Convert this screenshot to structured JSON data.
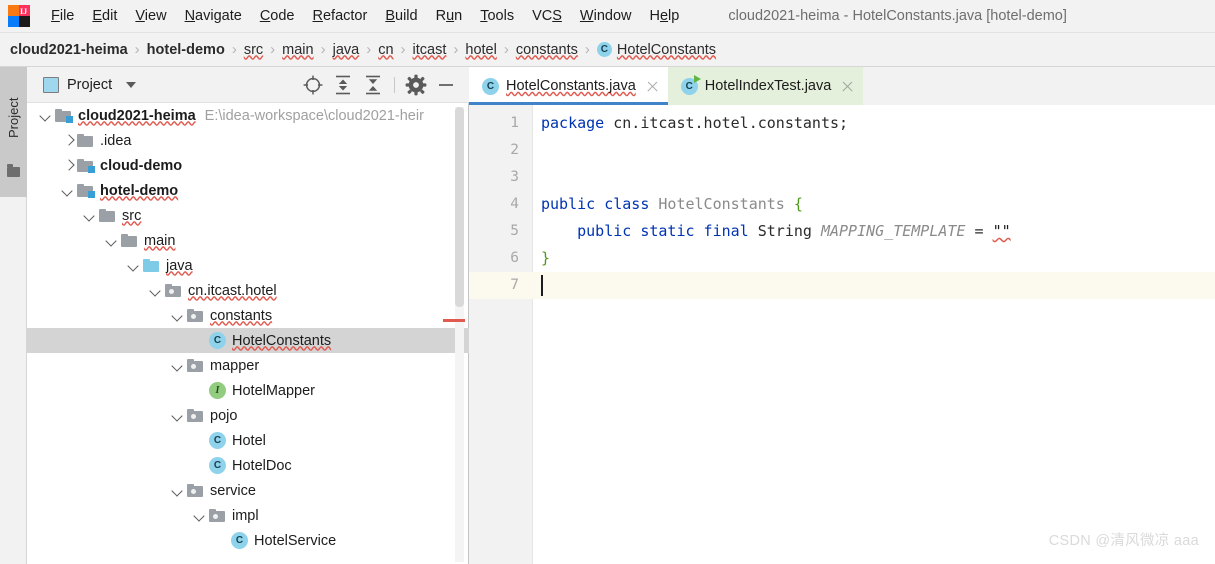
{
  "window": {
    "title": "cloud2021-heima - HotelConstants.java [hotel-demo]",
    "logo_letters": "IJ"
  },
  "menubar": {
    "items": [
      {
        "name": "file",
        "pre": "",
        "mn": "F",
        "post": "ile"
      },
      {
        "name": "edit",
        "pre": "",
        "mn": "E",
        "post": "dit"
      },
      {
        "name": "view",
        "pre": "",
        "mn": "V",
        "post": "iew"
      },
      {
        "name": "navigate",
        "pre": "",
        "mn": "N",
        "post": "avigate"
      },
      {
        "name": "code",
        "pre": "",
        "mn": "C",
        "post": "ode"
      },
      {
        "name": "refactor",
        "pre": "",
        "mn": "R",
        "post": "efactor"
      },
      {
        "name": "build",
        "pre": "",
        "mn": "B",
        "post": "uild"
      },
      {
        "name": "run",
        "pre": "R",
        "mn": "u",
        "post": "n"
      },
      {
        "name": "tools",
        "pre": "",
        "mn": "T",
        "post": "ools"
      },
      {
        "name": "vcs",
        "pre": "VC",
        "mn": "S",
        "post": ""
      },
      {
        "name": "window",
        "pre": "",
        "mn": "W",
        "post": "indow"
      },
      {
        "name": "help",
        "pre": "H",
        "mn": "e",
        "post": "lp"
      }
    ]
  },
  "breadcrumb": {
    "separator": "›",
    "items": [
      {
        "label": "cloud2021-heima",
        "bold": true,
        "squiggle": false,
        "icon": ""
      },
      {
        "label": "hotel-demo",
        "bold": true,
        "squiggle": false,
        "icon": ""
      },
      {
        "label": "src",
        "bold": false,
        "squiggle": true,
        "icon": ""
      },
      {
        "label": "main",
        "bold": false,
        "squiggle": true,
        "icon": ""
      },
      {
        "label": "java",
        "bold": false,
        "squiggle": true,
        "icon": ""
      },
      {
        "label": "cn",
        "bold": false,
        "squiggle": true,
        "icon": ""
      },
      {
        "label": "itcast",
        "bold": false,
        "squiggle": true,
        "icon": ""
      },
      {
        "label": "hotel",
        "bold": false,
        "squiggle": true,
        "icon": ""
      },
      {
        "label": "constants",
        "bold": false,
        "squiggle": true,
        "icon": ""
      },
      {
        "label": "HotelConstants",
        "bold": false,
        "squiggle": true,
        "icon": "class-badge",
        "badge_letter": "C"
      }
    ]
  },
  "toolstrip": {
    "project_tab_label": "Project",
    "project_tab_icon": "folder-icon"
  },
  "project_panel": {
    "title": "Project",
    "view_icon": "project-view-icon",
    "dropdown_icon": "chevron-down-icon",
    "actions": [
      {
        "name": "locate-in-tree-button",
        "icon": "crosshair-icon"
      },
      {
        "name": "expand-all-button",
        "icon": "expand-all-icon"
      },
      {
        "name": "collapse-all-button",
        "icon": "collapse-all-icon"
      },
      {
        "name": "settings-button",
        "icon": "gear-icon"
      },
      {
        "name": "hide-button",
        "icon": "minimize-icon"
      }
    ],
    "tree": [
      {
        "label": "cloud2021-heima",
        "path": "E:\\idea-workspace\\cloud2021-heir",
        "indent": 0,
        "twist": "open",
        "icon": "module-folder",
        "bold": true,
        "squiggle": true,
        "selected": false
      },
      {
        "label": ".idea",
        "path": "",
        "indent": 1,
        "twist": "closed",
        "icon": "folder",
        "bold": false,
        "squiggle": false,
        "selected": false
      },
      {
        "label": "cloud-demo",
        "path": "",
        "indent": 1,
        "twist": "closed",
        "icon": "module-folder",
        "bold": true,
        "squiggle": false,
        "selected": false
      },
      {
        "label": "hotel-demo",
        "path": "",
        "indent": 1,
        "twist": "open",
        "icon": "module-folder",
        "bold": true,
        "squiggle": true,
        "selected": false
      },
      {
        "label": "src",
        "path": "",
        "indent": 2,
        "twist": "open",
        "icon": "folder",
        "bold": false,
        "squiggle": true,
        "selected": false
      },
      {
        "label": "main",
        "path": "",
        "indent": 3,
        "twist": "open",
        "icon": "folder",
        "bold": false,
        "squiggle": true,
        "selected": false
      },
      {
        "label": "java",
        "path": "",
        "indent": 4,
        "twist": "open",
        "icon": "source-folder",
        "bold": false,
        "squiggle": true,
        "selected": false
      },
      {
        "label": "cn.itcast.hotel",
        "path": "",
        "indent": 5,
        "twist": "open",
        "icon": "package",
        "bold": false,
        "squiggle": true,
        "selected": false
      },
      {
        "label": "constants",
        "path": "",
        "indent": 6,
        "twist": "open",
        "icon": "package",
        "bold": false,
        "squiggle": true,
        "selected": false
      },
      {
        "label": "HotelConstants",
        "path": "",
        "indent": 7,
        "twist": "none",
        "icon": "class",
        "bold": false,
        "squiggle": true,
        "selected": true
      },
      {
        "label": "mapper",
        "path": "",
        "indent": 6,
        "twist": "open",
        "icon": "package",
        "bold": false,
        "squiggle": false,
        "selected": false
      },
      {
        "label": "HotelMapper",
        "path": "",
        "indent": 7,
        "twist": "none",
        "icon": "interface",
        "bold": false,
        "squiggle": false,
        "selected": false
      },
      {
        "label": "pojo",
        "path": "",
        "indent": 6,
        "twist": "open",
        "icon": "package",
        "bold": false,
        "squiggle": false,
        "selected": false
      },
      {
        "label": "Hotel",
        "path": "",
        "indent": 7,
        "twist": "none",
        "icon": "class",
        "bold": false,
        "squiggle": false,
        "selected": false
      },
      {
        "label": "HotelDoc",
        "path": "",
        "indent": 7,
        "twist": "none",
        "icon": "class",
        "bold": false,
        "squiggle": false,
        "selected": false
      },
      {
        "label": "service",
        "path": "",
        "indent": 6,
        "twist": "open",
        "icon": "package",
        "bold": false,
        "squiggle": false,
        "selected": false
      },
      {
        "label": "impl",
        "path": "",
        "indent": 7,
        "twist": "open",
        "icon": "package",
        "bold": false,
        "squiggle": false,
        "selected": false
      },
      {
        "label": "HotelService",
        "path": "",
        "indent": 8,
        "twist": "none",
        "icon": "class",
        "bold": false,
        "squiggle": false,
        "selected": false
      }
    ]
  },
  "editor_tabs": [
    {
      "label": "HotelConstants.java",
      "active": true,
      "icon": "class-icon",
      "squiggle": true,
      "close_icon": "close-icon"
    },
    {
      "label": "HotelIndexTest.java",
      "active": false,
      "icon": "test-class-icon",
      "squiggle": false,
      "close_icon": "close-icon"
    }
  ],
  "code": {
    "current_line": 7,
    "lines": [
      {
        "num": "1",
        "tokens": [
          {
            "t": "package ",
            "c": "kw"
          },
          {
            "t": "cn.itcast.hotel.constants;",
            "c": "plain"
          }
        ]
      },
      {
        "num": "2",
        "tokens": []
      },
      {
        "num": "3",
        "tokens": []
      },
      {
        "num": "4",
        "tokens": [
          {
            "t": "public class ",
            "c": "kw"
          },
          {
            "t": "HotelConstants ",
            "c": "type"
          },
          {
            "t": "{",
            "c": "brace"
          }
        ]
      },
      {
        "num": "5",
        "tokens": [
          {
            "t": "    public static final ",
            "c": "kw"
          },
          {
            "t": "String ",
            "c": "plain"
          },
          {
            "t": "MAPPING_TEMPLATE",
            "c": "field"
          },
          {
            "t": " = ",
            "c": "plain"
          },
          {
            "t": "\"\"",
            "c": "str sqwave"
          }
        ]
      },
      {
        "num": "6",
        "tokens": [
          {
            "t": "}",
            "c": "brace"
          }
        ]
      },
      {
        "num": "7",
        "tokens": []
      }
    ]
  },
  "watermark": {
    "text": "CSDN @清风微凉 aaa"
  },
  "colors": {
    "accent_blue": "#4083c9",
    "chrome_gray": "#f2f2f2",
    "selection_gray": "#d4d4d4",
    "current_line": "#fcfaef",
    "error_red": "#e05a4f",
    "class_icon": "#8ed2ec",
    "interface_icon": "#91cc7f",
    "test_tab_green": "#e5f0dc",
    "keyword_blue": "#0033b3"
  }
}
